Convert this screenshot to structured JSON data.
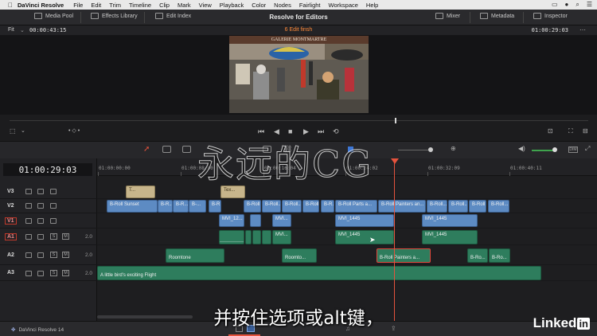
{
  "menubar": {
    "app": "DaVinci Resolve",
    "items": [
      "File",
      "Edit",
      "Trim",
      "Timeline",
      "Clip",
      "Mark",
      "View",
      "Playback",
      "Color",
      "Nodes",
      "Fairlight",
      "Workspace",
      "Help"
    ]
  },
  "toolbar": {
    "media_pool": "Media Pool",
    "effects_library": "Effects Library",
    "edit_index": "Edit Index",
    "title": "Resolve for Editors",
    "mixer": "Mixer",
    "metadata": "Metadata",
    "inspector": "Inspector"
  },
  "viewer": {
    "fit": "Fit",
    "source_tc": "00:00:43:15",
    "timeline_name": "6 Edit finsh",
    "record_tc": "01:00:29:03",
    "video_sign": "GALERIE MONTMARTRE"
  },
  "timeline": {
    "current_tc": "01:00:29:03",
    "ruler": [
      "01:00:00:00",
      "01:00:08:00",
      "01:00:16:04",
      "01:00:24:02",
      "01:00:32:09",
      "01:00:40:11"
    ],
    "tracks": [
      {
        "name": "V3",
        "volume": ""
      },
      {
        "name": "V2",
        "volume": ""
      },
      {
        "name": "V1",
        "volume": ""
      },
      {
        "name": "A1",
        "volume": "2.0"
      },
      {
        "name": "A2",
        "volume": "2.0"
      },
      {
        "name": "A3",
        "volume": "2.0"
      }
    ],
    "clips": {
      "v3_a": "T...",
      "v3_b": "Tex...",
      "v2_broll_sunset": "B-Roll Sunset",
      "v2_br1": "B-R...",
      "v2_br2": "B-R...",
      "v2_b": "B-...",
      "v2_br3": "B-R...",
      "v2_broll4": "B-Roll...",
      "v2_broll5": "B-Roll...",
      "v2_broll6": "B-Roll...",
      "v2_parts": "B-Roll Parts a...",
      "v2_painters": "B-Roll Painters an...",
      "v2_broll7": "B-Roll...",
      "v2_broll8": "B-Roll...",
      "v2_broll9": "B-Roll...",
      "v1_mvi12": "MVI_12...",
      "v1_mvi": "MVI...",
      "v1_mvi1445a": "MVI_1445",
      "v1_mvi1445b": "MVI_1445",
      "a1_mvi": "MVI...",
      "a1_mvi1445a": "MVI_1445",
      "a1_mvi1445b": "MVI_1445",
      "a2_roomtone1": "Roomtone",
      "a2_roomtone2": "Roomto...",
      "a2_painters": "B-Roll Painters a...",
      "a2_br1": "B-Ro...",
      "a2_br2": "B-Ro...",
      "a3_bird": "A little bird's exciting Flight"
    }
  },
  "footer": {
    "brand": "DaVinci Resolve 14",
    "subtitle": "并按住选项或alt键，",
    "watermark": "永远的CG",
    "logo": "Linked",
    "logo_in": "in"
  }
}
